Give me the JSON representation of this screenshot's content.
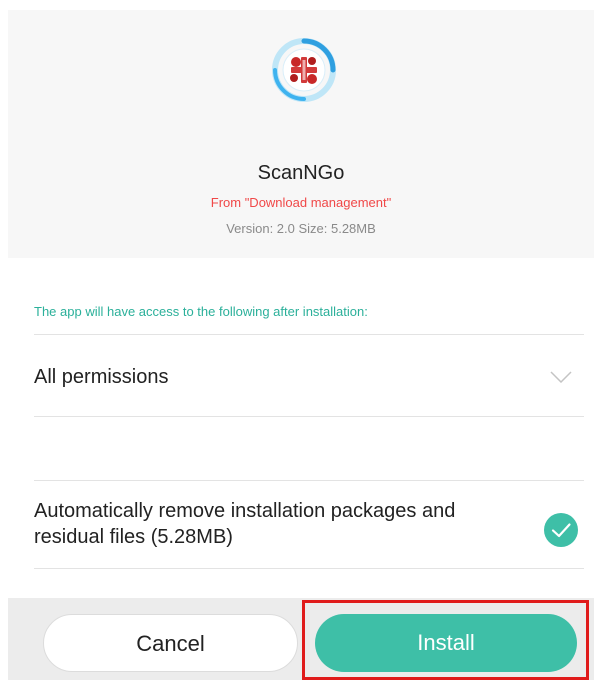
{
  "app": {
    "name": "ScanNGo",
    "source": "From \"Download management\"",
    "meta": "Version:  2.0   Size: 5.28MB",
    "icon": "scanngo-app-icon"
  },
  "permissions": {
    "access_note": "The app will have access to the following after installation:",
    "summary_label": "All permissions",
    "expand_icon": "chevron-down-icon"
  },
  "cleanup": {
    "label": "Automatically remove installation packages and residual files (5.28MB)",
    "checked": true,
    "check_icon": "check-circle-icon"
  },
  "footer": {
    "cancel_label": "Cancel",
    "install_label": "Install"
  },
  "colors": {
    "accent": "#3ebfa7",
    "source_text": "#f04848",
    "highlight_box": "#e01b1b"
  }
}
